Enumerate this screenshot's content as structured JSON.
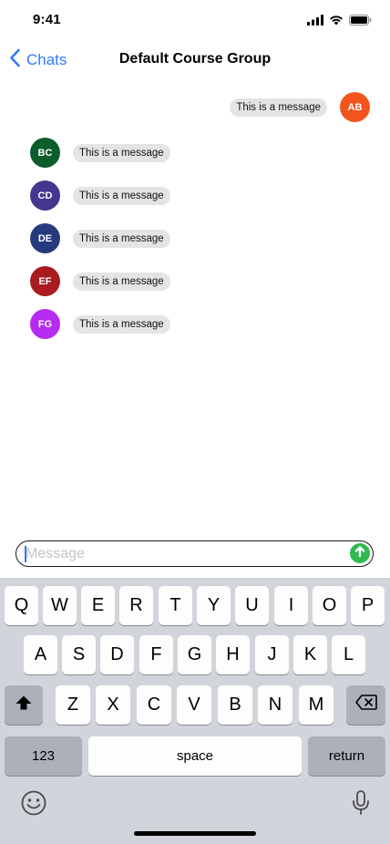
{
  "status_bar": {
    "time": "9:41"
  },
  "nav": {
    "back_label": "Chats",
    "title": "Default Course Group"
  },
  "messages": [
    {
      "initials": "AB",
      "text": "This is a message",
      "color": "#f2541e",
      "side": "right"
    },
    {
      "initials": "BC",
      "text": "This is a message",
      "color": "#0b5e2a",
      "side": "left"
    },
    {
      "initials": "CD",
      "text": "This is a message",
      "color": "#453690",
      "side": "left"
    },
    {
      "initials": "DE",
      "text": "This is a message",
      "color": "#263a7e",
      "side": "left"
    },
    {
      "initials": "EF",
      "text": "This is a message",
      "color": "#a91b1f",
      "side": "left"
    },
    {
      "initials": "FG",
      "text": "This is a message",
      "color": "#b62bf0",
      "side": "left"
    }
  ],
  "composer": {
    "placeholder": "Message",
    "value": ""
  },
  "keyboard": {
    "row1": [
      "Q",
      "W",
      "E",
      "R",
      "T",
      "Y",
      "U",
      "I",
      "O",
      "P"
    ],
    "row2": [
      "A",
      "S",
      "D",
      "F",
      "G",
      "H",
      "J",
      "K",
      "L"
    ],
    "row3": [
      "Z",
      "X",
      "C",
      "V",
      "B",
      "N",
      "M"
    ],
    "numbers_label": "123",
    "space_label": "space",
    "return_label": "return"
  },
  "colors": {
    "accent": "#2f7cf6",
    "send": "#2fb94e",
    "keyboard_bg": "#d1d4da",
    "bubble": "#e4e4e4"
  },
  "icons": {
    "signal": "cellular-signal-icon",
    "wifi": "wifi-icon",
    "battery": "battery-icon",
    "back": "chevron-left-icon",
    "send": "arrow-up-circle-icon",
    "shift": "shift-icon",
    "delete": "backspace-icon",
    "emoji": "emoji-icon",
    "dictation": "microphone-icon"
  }
}
